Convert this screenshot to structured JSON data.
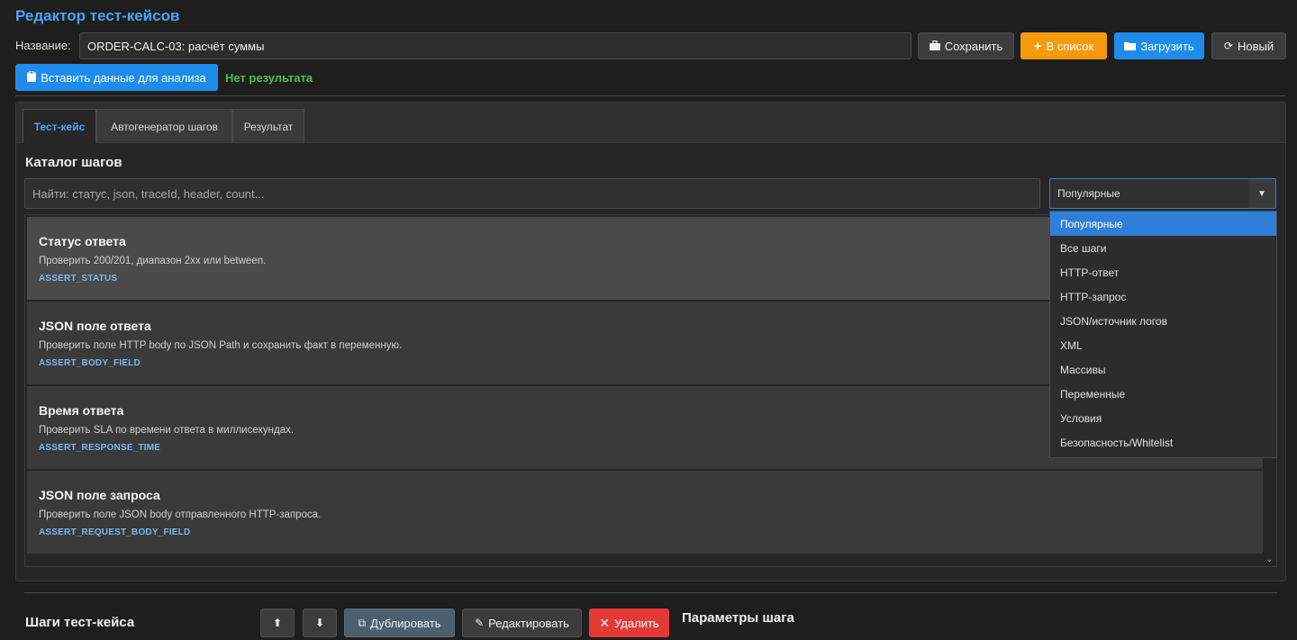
{
  "app": {
    "title": "Редактор тест-кейсов"
  },
  "header": {
    "name_label": "Название:",
    "name_value": "ORDER-CALC-03: расчёт суммы",
    "save_label": "Сохранить",
    "add_to_list_label": "В список",
    "load_label": "Загрузить",
    "new_label": "Новый",
    "paste_label": "Вставить данные для анализа",
    "result_status": "Нет результата"
  },
  "tabs": [
    {
      "label": "Тест-кейс",
      "active": true
    },
    {
      "label": "Автогенератор шагов",
      "active": false
    },
    {
      "label": "Результат",
      "active": false
    }
  ],
  "catalog": {
    "title": "Каталог шагов",
    "search_placeholder": "Найти: статус, json, traceId, header, count...",
    "filter_selected": "Популярные",
    "filter_options": [
      "Популярные",
      "Все шаги",
      "HTTP-ответ",
      "HTTP-запрос",
      "JSON/источник логов",
      "XML",
      "Массивы",
      "Переменные",
      "Условия",
      "Безопасность/Whitelist"
    ],
    "steps": [
      {
        "title": "Статус ответа",
        "desc": "Проверить 200/201, диапазон 2xx или between.",
        "code": "ASSERT_STATUS"
      },
      {
        "title": "JSON поле ответа",
        "desc": "Проверить поле HTTP body по JSON Path и сохранить факт в переменную.",
        "code": "ASSERT_BODY_FIELD"
      },
      {
        "title": "Время ответа",
        "desc": "Проверить SLA по времени ответа в миллисекундах.",
        "code": "ASSERT_RESPONSE_TIME"
      },
      {
        "title": "JSON поле запроса",
        "desc": "Проверить поле JSON body отправленного HTTP-запроса.",
        "code": "ASSERT_REQUEST_BODY_FIELD"
      }
    ]
  },
  "steps_section": {
    "title": "Шаги тест-кейса",
    "duplicate_label": "Дублировать",
    "edit_label": "Редактировать",
    "delete_label": "Удалить",
    "params_title": "Параметры шага"
  },
  "colors": {
    "accent": "#4da3f5",
    "ok": "#4fbf4f",
    "orange": "#f59a0c",
    "blue": "#1f8ceb",
    "red": "#e53935"
  }
}
